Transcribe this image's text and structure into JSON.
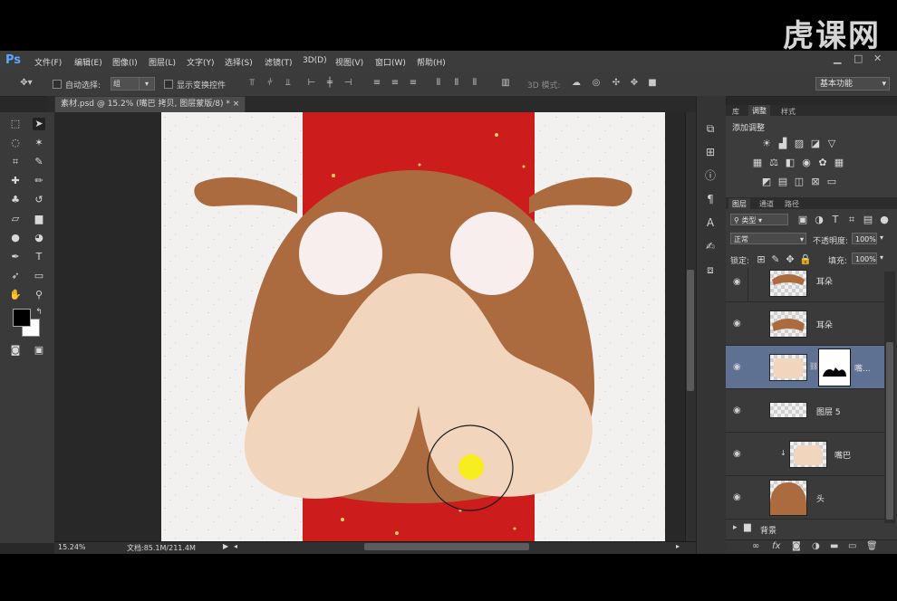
{
  "watermark": "虎课网",
  "app": {
    "logo": "Ps"
  },
  "menu": [
    "文件(F)",
    "编辑(E)",
    "图像(I)",
    "图层(L)",
    "文字(Y)",
    "选择(S)",
    "滤镜(T)",
    "3D(D)",
    "视图(V)",
    "窗口(W)",
    "帮助(H)"
  ],
  "window_controls": {
    "minimize": "▁",
    "restore": "□",
    "close": "✕"
  },
  "options": {
    "auto_select_label": "自动选择:",
    "auto_select_value": "组",
    "show_transform_label": "显示变换控件",
    "mode_3d_label": "3D 模式:",
    "workspace": "基本功能"
  },
  "document_tab": {
    "title": "素材.psd @ 15.2% (嘴巴 拷贝, 图层蒙版/8) *",
    "close": "×"
  },
  "status": {
    "zoom": "15.24%",
    "doc_size": "文档:85.1M/211.4M"
  },
  "adjust_panel": {
    "tabs": [
      "库",
      "调整",
      "样式"
    ],
    "active_tab": "调整",
    "title": "添加调整"
  },
  "layers_panel": {
    "tabs": [
      "图层",
      "通道",
      "路径"
    ],
    "active_tab": "图层",
    "filter_kind": "类型",
    "blend_mode": "正常",
    "opacity_label": "不透明度:",
    "opacity": "100%",
    "lock_label": "锁定:",
    "fill_label": "填充:",
    "fill": "100%",
    "layers": [
      {
        "name": "耳朵",
        "thumb": "ear"
      },
      {
        "name": "耳朵",
        "thumb": "ear"
      },
      {
        "name": "嘴...",
        "thumb": "mouth",
        "selected": true,
        "has_mask": true
      },
      {
        "name": "图层 5",
        "thumb": "empty"
      },
      {
        "name": "嘴巴",
        "thumb": "mouth",
        "clipped": true
      },
      {
        "name": "头",
        "thumb": "head"
      }
    ],
    "group": {
      "name": "背景"
    }
  },
  "colors": {
    "red_band": "#cc1c1c",
    "head_brown": "#ac6a3f",
    "snout_peach": "#f1d6bd",
    "eye_white": "#f8eeee",
    "selection_highlight": "#5e7192",
    "cursor_dot": "#f6ee1e"
  }
}
